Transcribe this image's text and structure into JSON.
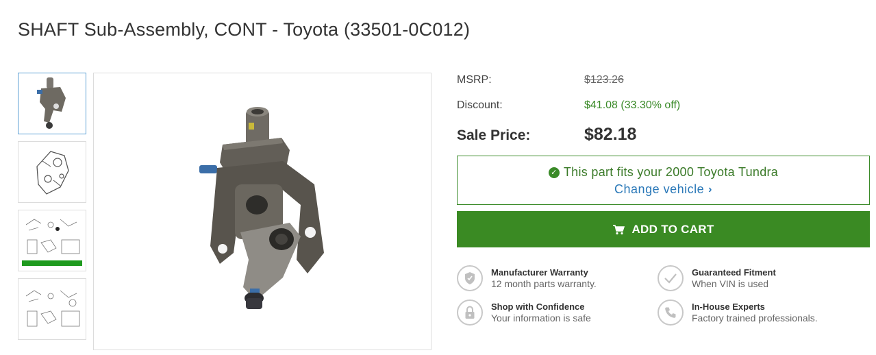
{
  "product": {
    "title": "SHAFT Sub-Assembly, CONT - Toyota (33501-0C012)"
  },
  "thumbnails": [
    {
      "name": "product-photo"
    },
    {
      "name": "line-drawing"
    },
    {
      "name": "diagram-highlighted"
    },
    {
      "name": "diagram"
    }
  ],
  "pricing": {
    "msrp_label": "MSRP:",
    "msrp_value": "$123.26",
    "discount_label": "Discount:",
    "discount_value": "$41.08 (33.30% off)",
    "sale_label": "Sale Price:",
    "sale_value": "$82.18"
  },
  "fitment": {
    "message": "This part fits your 2000 Toyota Tundra",
    "change_link": "Change vehicle"
  },
  "cart": {
    "button_label": "ADD TO CART"
  },
  "features": [
    {
      "title": "Manufacturer Warranty",
      "desc": "12 month parts warranty.",
      "icon": "shield-icon"
    },
    {
      "title": "Guaranteed Fitment",
      "desc": "When VIN is used",
      "icon": "checkmark-icon"
    },
    {
      "title": "Shop with Confidence",
      "desc": "Your information is safe",
      "icon": "lock-icon"
    },
    {
      "title": "In-House Experts",
      "desc": "Factory trained professionals.",
      "icon": "phone-icon"
    }
  ],
  "colors": {
    "accent_green": "#3a8a23",
    "link_blue": "#2a78b8"
  }
}
